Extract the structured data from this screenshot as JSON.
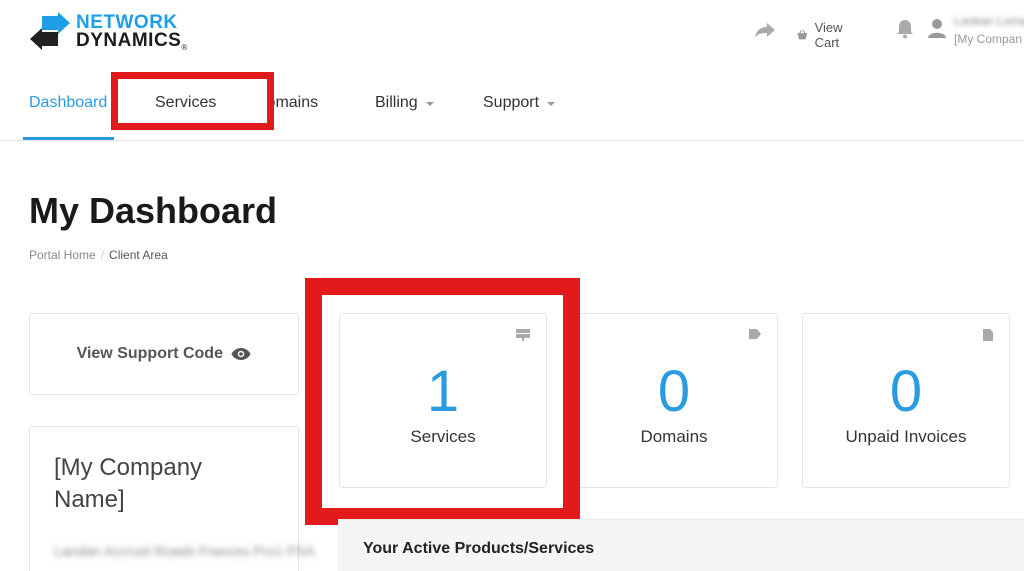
{
  "brand": {
    "line1": "NETWORK",
    "line2": "DYNAMICS",
    "reg": "®",
    "primary_color": "#1e9ee6"
  },
  "header": {
    "share_icon": "share-icon",
    "cart_label": "View Cart",
    "notifications_icon": "bell-icon",
    "user_icon": "user-icon",
    "user_name": "Lankan Lomas",
    "user_company": "[My Compan"
  },
  "nav": {
    "items": [
      {
        "label": "Dashboard",
        "active": true
      },
      {
        "label": "Services"
      },
      {
        "label": "Domains"
      },
      {
        "label": "Billing",
        "dropdown": true
      },
      {
        "label": "Support",
        "dropdown": true
      }
    ]
  },
  "page": {
    "title": "My Dashboard",
    "breadcrumb": [
      "Portal Home",
      "Client Area"
    ]
  },
  "support_card": {
    "label": "View Support Code",
    "icon": "eye-icon"
  },
  "company_card": {
    "name": "[My Company Name]",
    "address": "Landan Accrust Roads Frances Pro1 PSA"
  },
  "stats": [
    {
      "value": "1",
      "label": "Services",
      "icon": "server-icon"
    },
    {
      "value": "0",
      "label": "Domains",
      "icon": "tag-icon"
    },
    {
      "value": "0",
      "label": "Unpaid Invoices",
      "icon": "document-icon"
    }
  ],
  "active_products": {
    "title": "Your Active Products/Services"
  },
  "highlight_color": "#e31a1c",
  "accent_color": "#2b9be0"
}
